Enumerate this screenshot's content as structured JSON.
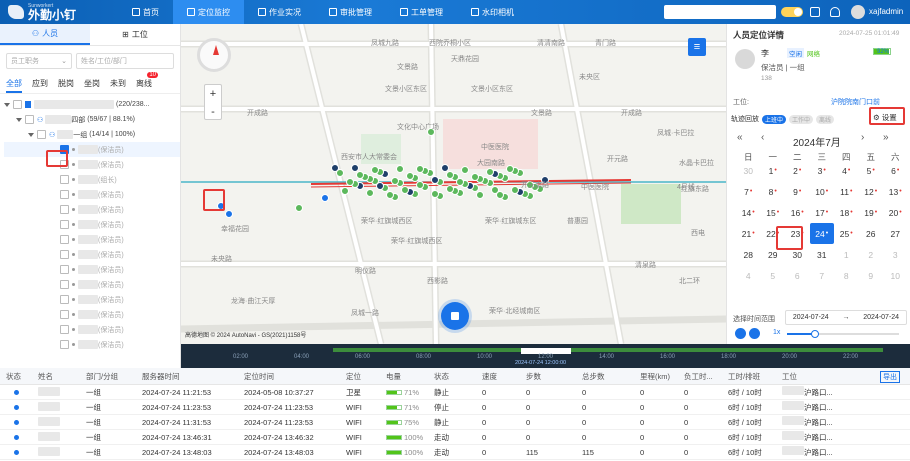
{
  "topbar": {
    "brand_en": "Sunworkert",
    "brand": "外勤小钉",
    "nav": [
      {
        "label": "首页",
        "icon": "home-icon"
      },
      {
        "label": "定位监控",
        "icon": "location-icon",
        "active": true
      },
      {
        "label": "作业实况",
        "icon": "image-icon"
      },
      {
        "label": "审批管理",
        "icon": "approve-icon"
      },
      {
        "label": "工单管理",
        "icon": "doc-icon"
      },
      {
        "label": "水印相机",
        "icon": "camera-icon"
      }
    ],
    "username": "xajfadmin"
  },
  "left": {
    "tabs": [
      "人员",
      "工位"
    ],
    "filter_job_placeholder": "员工职务",
    "filter_search_placeholder": "姓名/工位/部门",
    "status_tabs": [
      "全部",
      "应到",
      "脱岗",
      "坐岗",
      "未到",
      "离线"
    ],
    "status_badge": "10",
    "tree": {
      "root_count": "(220/238...",
      "dept_suffix": "四部",
      "dept_count": "(59/67 | 88.1%)",
      "group_suffix": "一组",
      "group_count": "(14/14 | 100%)",
      "members": [
        "(保洁员)",
        "(保洁员)",
        "(组长)",
        "(保洁员)",
        "(保洁员)",
        "(保洁员)",
        "(保洁员)",
        "(保洁员)",
        "(保洁员)",
        "(保洁员)",
        "(保洁员)",
        "(保洁员)",
        "(保洁员)",
        "(保洁员)"
      ]
    }
  },
  "map": {
    "streets": [
      "凤城九路",
      "西院乔桐小区",
      "清清南路",
      "青门路",
      "文景小区东区",
      "天鼎花园",
      "开成路",
      "文景路",
      "文景小区东区",
      "未央区",
      "开成路",
      "文化中心广场",
      "中医医院",
      "开元路",
      "凤城·卡巴拉",
      "红旗东路",
      "水晶卡巴拉",
      "西安市人大常委会",
      "未央路",
      "中医医院",
      "开元南路",
      "大园南路",
      "普惠园",
      "幸福花园",
      "荣华·红旗城西区",
      "荣华·红旗城东区",
      "西电",
      "文景路",
      "荣华·红旗城西区",
      "明仪路",
      "龙海·曲江天厚",
      "西影路",
      "凤城一路",
      "荣华·北经城南区",
      "清泉路",
      "北二环",
      "4号线"
    ],
    "attribution": "高德地图 © 2024 AutoNavi - GS(2021)1158号"
  },
  "timeline": {
    "ticks": [
      "02:00",
      "04:00",
      "06:00",
      "08:00",
      "10:00",
      "12:00",
      "14:00",
      "16:00",
      "18:00",
      "20:00",
      "22:00"
    ],
    "cursor_label": "2024-07-24 12:00:00"
  },
  "right": {
    "title": "人员定位详情",
    "timestamp": "2024-07-25 01:01:49",
    "person_name": "李",
    "status_tag": "空闲",
    "net_tag": "网络",
    "role": "保洁员",
    "group": "一组",
    "phone": "138",
    "battery": "92%",
    "post_label": "工位:",
    "post_value": "沪院院南门口前",
    "track_label": "轨迹回放",
    "toggle1": "上班中",
    "toggle2": "工作中",
    "toggle3": "离线",
    "settings_label": "设置",
    "month_title": "2024年7月",
    "weekdays": [
      "日",
      "一",
      "二",
      "三",
      "四",
      "五",
      "六"
    ],
    "days": [
      {
        "d": "30",
        "m": true
      },
      {
        "d": "1",
        "r": true
      },
      {
        "d": "2",
        "r": true
      },
      {
        "d": "3",
        "r": true
      },
      {
        "d": "4",
        "r": true
      },
      {
        "d": "5",
        "r": true
      },
      {
        "d": "6",
        "r": true
      },
      {
        "d": "7",
        "r": true
      },
      {
        "d": "8",
        "r": true
      },
      {
        "d": "9",
        "r": true
      },
      {
        "d": "10",
        "r": true
      },
      {
        "d": "11",
        "r": true
      },
      {
        "d": "12",
        "r": true
      },
      {
        "d": "13",
        "r": true
      },
      {
        "d": "14",
        "r": true
      },
      {
        "d": "15",
        "r": true
      },
      {
        "d": "16",
        "r": true
      },
      {
        "d": "17",
        "r": true
      },
      {
        "d": "18",
        "r": true
      },
      {
        "d": "19",
        "r": true
      },
      {
        "d": "20",
        "r": true
      },
      {
        "d": "21",
        "r": true
      },
      {
        "d": "22",
        "r": true
      },
      {
        "d": "23",
        "r": true
      },
      {
        "d": "24",
        "r": true,
        "sel": true
      },
      {
        "d": "25",
        "r": true
      },
      {
        "d": "26"
      },
      {
        "d": "27"
      },
      {
        "d": "28"
      },
      {
        "d": "29"
      },
      {
        "d": "30"
      },
      {
        "d": "31"
      },
      {
        "d": "1",
        "m": true
      },
      {
        "d": "2",
        "m": true
      },
      {
        "d": "3",
        "m": true
      },
      {
        "d": "4",
        "m": true
      },
      {
        "d": "5",
        "m": true
      },
      {
        "d": "6",
        "m": true
      },
      {
        "d": "7",
        "m": true
      },
      {
        "d": "8",
        "m": true
      },
      {
        "d": "9",
        "m": true
      },
      {
        "d": "10",
        "m": true
      }
    ],
    "range_label": "选择时间范围",
    "range_start": "2024-07-24",
    "range_end": "2024-07-24",
    "speed": "1x"
  },
  "table": {
    "export_label": "导出",
    "headers": [
      "状态",
      "姓名",
      "部门/分组",
      "服务器时间",
      "定位时间",
      "定位",
      "电量",
      "状态",
      "速度",
      "步数",
      "总步数",
      "里程(km)",
      "负工时...",
      "工时/排班",
      "工位"
    ],
    "rows": [
      {
        "group": "一组",
        "server": "2024-07-24 11:21:53",
        "loc_time": "2024-05-08 10:37:27",
        "loc": "卫星",
        "battery": "71%",
        "battery_level": 0.71,
        "state": "静止",
        "speed": "0",
        "steps": "0",
        "total": "0",
        "km": "0",
        "neg": "0",
        "hours": "6时 / 10时",
        "post": "沪路口..."
      },
      {
        "group": "一组",
        "server": "2024-07-24 11:23:53",
        "loc_time": "2024-07-24 11:23:53",
        "loc": "WIFI",
        "battery": "71%",
        "battery_level": 0.71,
        "state": "停止",
        "speed": "0",
        "steps": "0",
        "total": "0",
        "km": "0",
        "neg": "0",
        "hours": "6时 / 10时",
        "post": "沪路口..."
      },
      {
        "group": "一组",
        "server": "2024-07-24 11:31:53",
        "loc_time": "2024-07-24 11:23:53",
        "loc": "WIFI",
        "battery": "75%",
        "battery_level": 0.75,
        "state": "静止",
        "speed": "0",
        "steps": "0",
        "total": "0",
        "km": "0",
        "neg": "0",
        "hours": "6时 / 10时",
        "post": "沪路口..."
      },
      {
        "group": "一组",
        "server": "2024-07-24 13:46:31",
        "loc_time": "2024-07-24 13:46:32",
        "loc": "WIFI",
        "battery": "100%",
        "battery_level": 1.0,
        "state": "走动",
        "speed": "0",
        "steps": "0",
        "total": "0",
        "km": "0",
        "neg": "0",
        "hours": "6时 / 10时",
        "post": "沪路口..."
      },
      {
        "group": "一组",
        "server": "2024-07-24 13:48:03",
        "loc_time": "2024-07-24 13:48:03",
        "loc": "WIFI",
        "battery": "100%",
        "battery_level": 1.0,
        "state": "走动",
        "speed": "0",
        "steps": "115",
        "total": "115",
        "km": "0",
        "neg": "0",
        "hours": "6时 / 10时",
        "post": "沪路口..."
      }
    ]
  }
}
